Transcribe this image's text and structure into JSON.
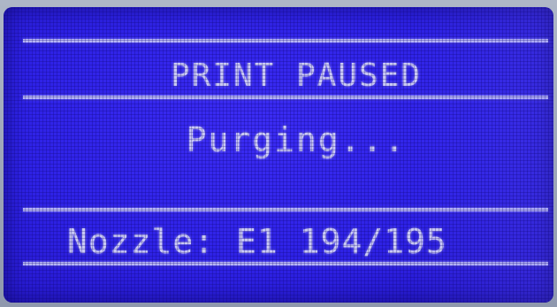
{
  "screen": {
    "title": "PRINT PAUSED",
    "status": "Purging...",
    "nozzle_line": "Nozzle: E1 194/195"
  },
  "colors": {
    "lcd_background": "#2e22e6",
    "lcd_text": "#c9c9f4",
    "separator": "#c5c6f6"
  }
}
